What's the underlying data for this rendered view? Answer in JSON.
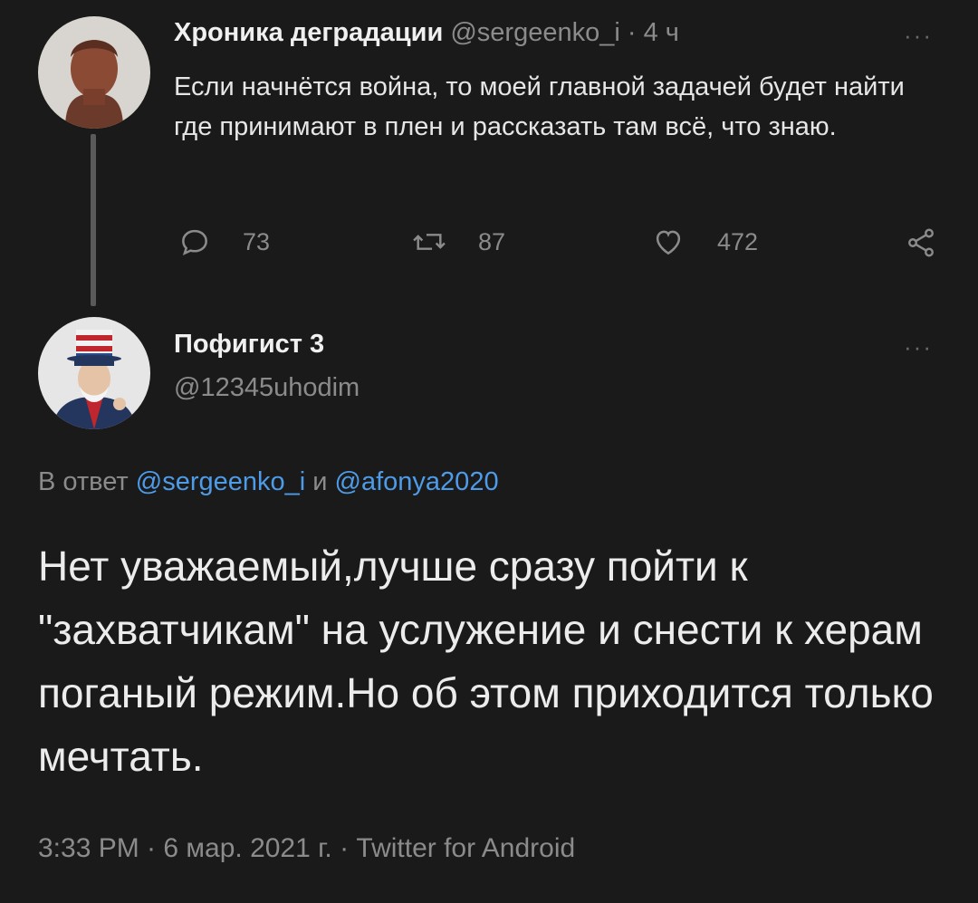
{
  "tweet1": {
    "author_name": "Хроника деградации",
    "handle": "@sergeenko_i",
    "separator": "·",
    "time": "4 ч",
    "text": "Если начнётся война, то моей главной задачей будет найти где принимают в плен и рассказать там всё, что знаю.",
    "replies": "73",
    "retweets": "87",
    "likes": "472",
    "more": "···"
  },
  "tweet2": {
    "author_name": "Пофигист 3",
    "handle": "@12345uhodim",
    "more": "···",
    "reply_prefix": "В ответ",
    "reply_to_1": "@sergeenko_i",
    "reply_conj": "и",
    "reply_to_2": "@afonya2020",
    "text": "Нет уважаемый,лучше сразу пойти к \"захватчикам\" на услужение и снести к херам поганый режим.Но об этом приходится только мечтать.",
    "timestamp": "3:33 PM · 6 мар. 2021 г. · Twitter for Android"
  },
  "colors": {
    "background": "#1a1a1a",
    "link": "#4e9be8",
    "muted": "#8b8b8b"
  }
}
